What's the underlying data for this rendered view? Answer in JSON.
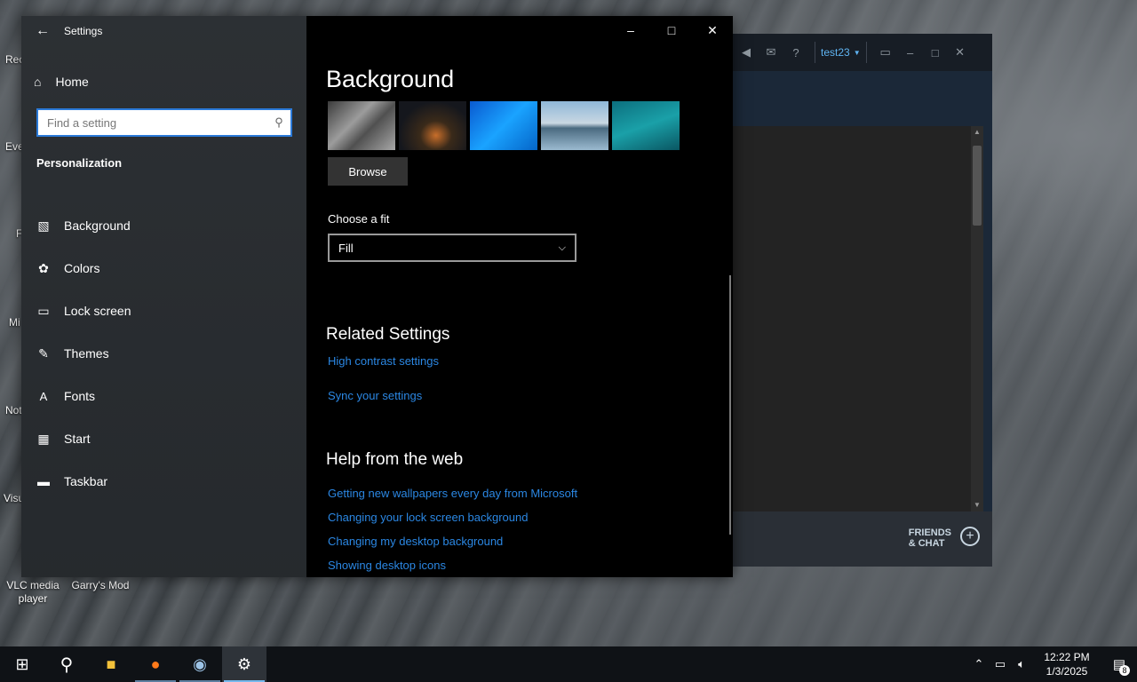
{
  "desktop": {
    "edge_labels": [
      "Rec",
      "Eve",
      "F",
      "Mi",
      "Not",
      "Visu"
    ],
    "icons": [
      {
        "label": "VLC media player"
      },
      {
        "label": "Garry's Mod"
      }
    ]
  },
  "steam": {
    "username": "test23",
    "help_label": "?",
    "friends_line1": "FRIENDS",
    "friends_line2": "& CHAT"
  },
  "settings": {
    "app_title": "Settings",
    "home_label": "Home",
    "search": {
      "placeholder": "Find a setting"
    },
    "section": "Personalization",
    "nav": [
      {
        "label": "Background",
        "icon": "image-icon"
      },
      {
        "label": "Colors",
        "icon": "palette-icon"
      },
      {
        "label": "Lock screen",
        "icon": "lock-screen-icon"
      },
      {
        "label": "Themes",
        "icon": "brush-icon"
      },
      {
        "label": "Fonts",
        "icon": "font-icon"
      },
      {
        "label": "Start",
        "icon": "start-grid-icon"
      },
      {
        "label": "Taskbar",
        "icon": "taskbar-icon"
      }
    ],
    "page_title": "Background",
    "browse_label": "Browse",
    "fit_label": "Choose a fit",
    "fit_value": "Fill",
    "related_title": "Related Settings",
    "related_links": [
      "High contrast settings",
      "Sync your settings"
    ],
    "help_title": "Help from the web",
    "help_links": [
      "Getting new wallpapers every day from Microsoft",
      "Changing your lock screen background",
      "Changing my desktop background",
      "Showing desktop icons"
    ]
  },
  "taskbar": {
    "time": "12:22 PM",
    "date": "1/3/2025",
    "notification_count": "8"
  }
}
